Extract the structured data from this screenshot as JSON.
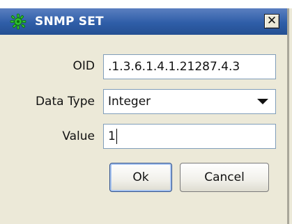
{
  "window": {
    "title": "SNMP SET",
    "close_glyph": "✕",
    "icon": "snmp-gear-icon"
  },
  "form": {
    "oid_label": "OID",
    "oid_value": ".1.3.6.1.4.1.21287.4.3",
    "datatype_label": "Data Type",
    "datatype_selected": "Integer",
    "value_label": "Value",
    "value_value": "1"
  },
  "buttons": {
    "ok_label": "Ok",
    "cancel_label": "Cancel"
  },
  "colors": {
    "titlebar": "#2f5ea8",
    "icon_green": "#2fbf2f",
    "field_border": "#7f9db9"
  }
}
